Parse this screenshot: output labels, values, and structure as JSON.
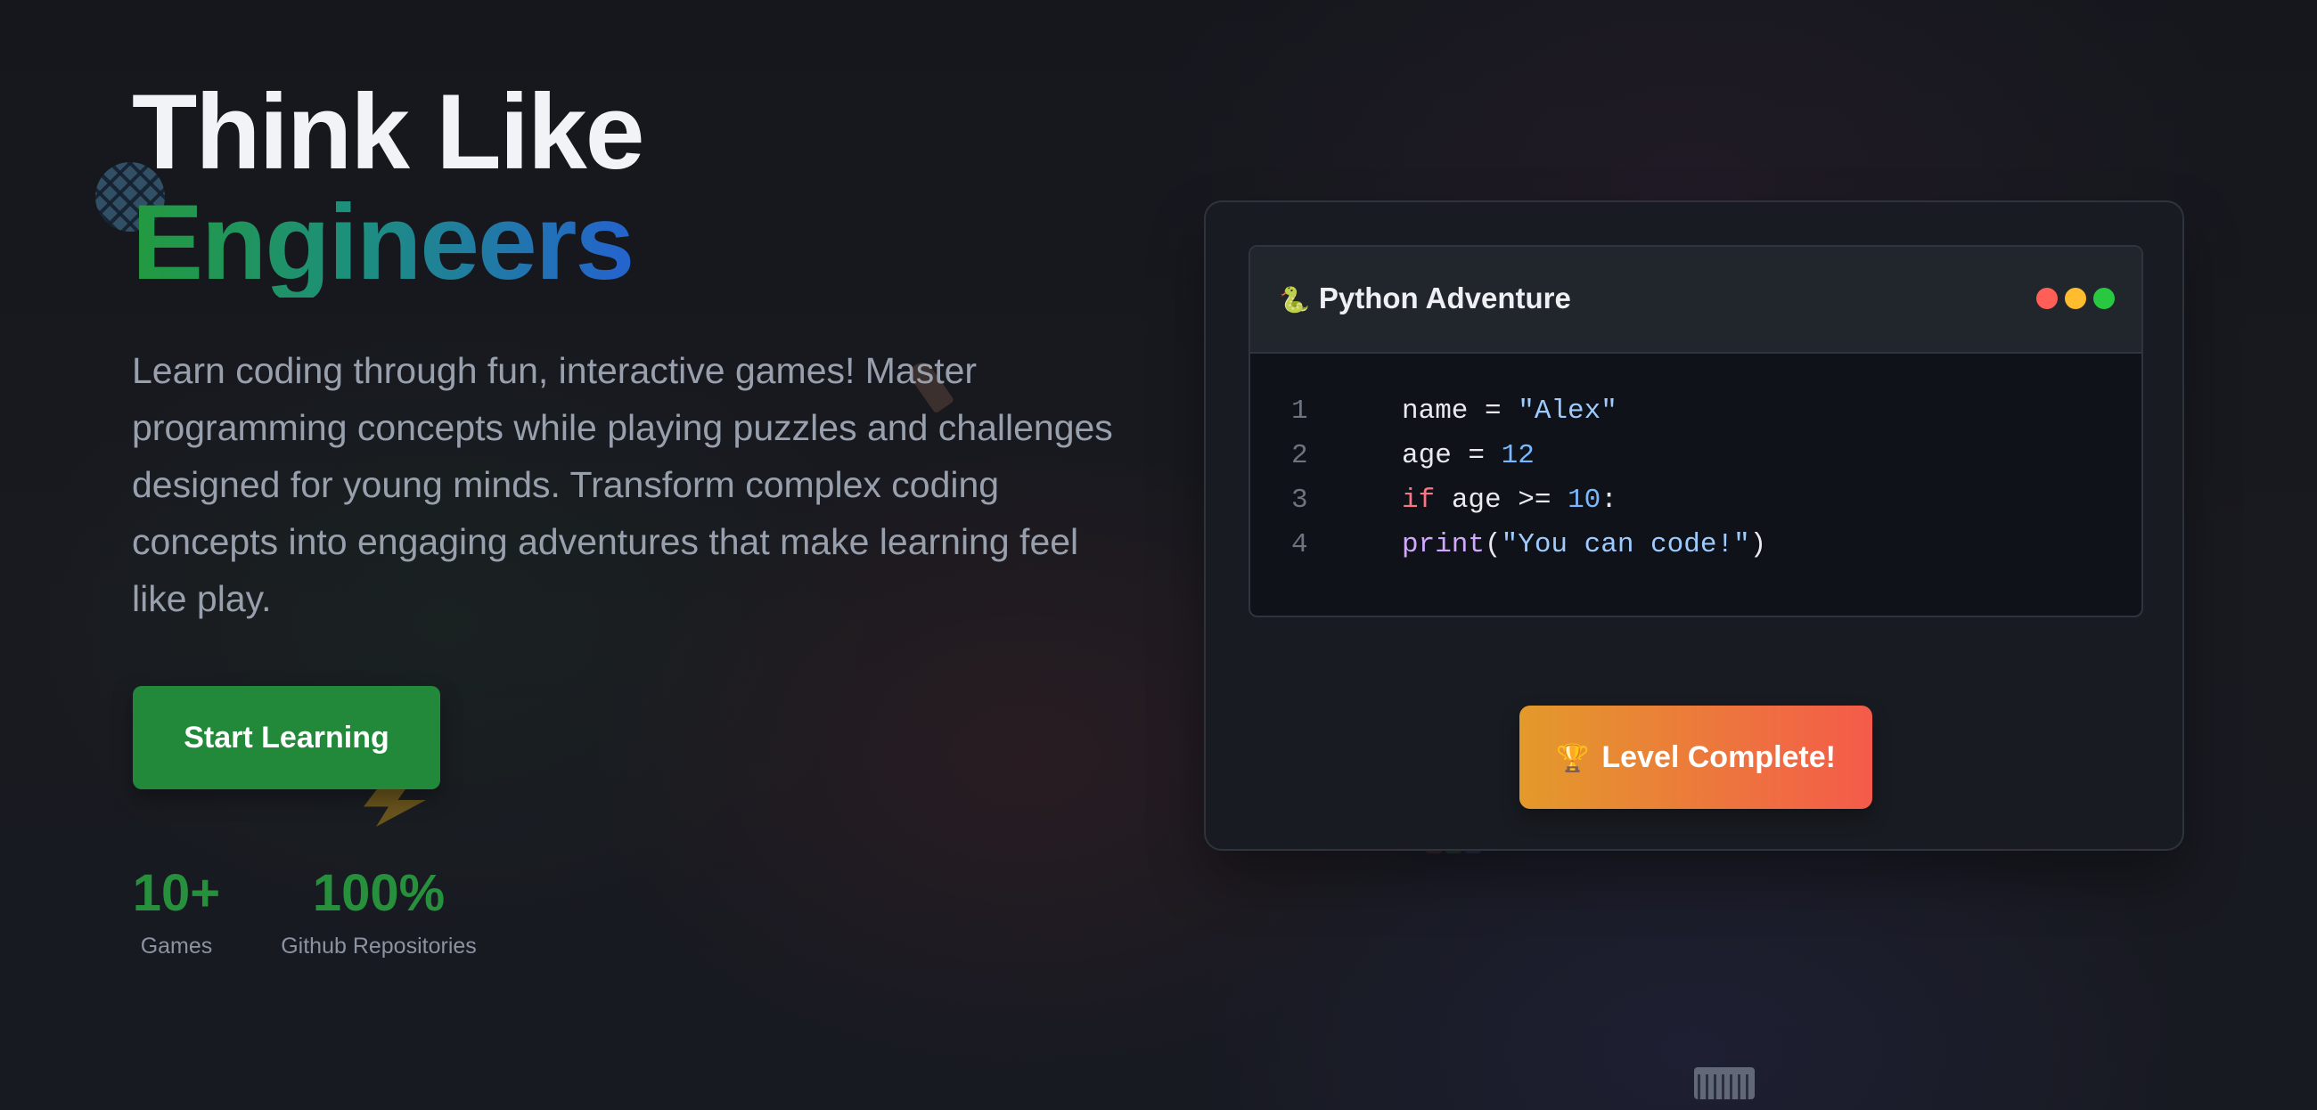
{
  "hero": {
    "title_line1": "Think Like",
    "title_line2": "Engineers",
    "description": "Learn coding through fun, interactive games! Master programming concepts while playing puzzles and challenges designed for young minds. Transform complex coding concepts into engaging adventures that make learning feel like play.",
    "cta_label": "Start Learning"
  },
  "stats": [
    {
      "value": "10+",
      "label": "Games"
    },
    {
      "value": "100%",
      "label": "Github Repositories"
    }
  ],
  "demo": {
    "window_icon": "snake-icon",
    "window_title": "Python Adventure",
    "code_lines": [
      {
        "number": "1",
        "text": "name = \"Alex\""
      },
      {
        "number": "2",
        "text": "age = 12"
      },
      {
        "number": "3",
        "text": "if age >= 10:"
      },
      {
        "number": "4",
        "text": "print(\"You can code!\")"
      }
    ],
    "level_icon": "trophy-icon",
    "level_label": "Level Complete!"
  },
  "colors": {
    "primary_green": "#23893a",
    "gradient_green": "#239a3e",
    "gradient_blue": "#2463d0",
    "level_gradient_start": "#e39a2b",
    "level_gradient_end": "#f45b4a",
    "window_dot_red": "#ff5f57",
    "window_dot_yellow": "#febc2e",
    "window_dot_green": "#28c840"
  },
  "decorative_icons": [
    "basketball-icon",
    "lightning-icon",
    "rocket-icon",
    "dice-icon",
    "laptop-icon"
  ]
}
